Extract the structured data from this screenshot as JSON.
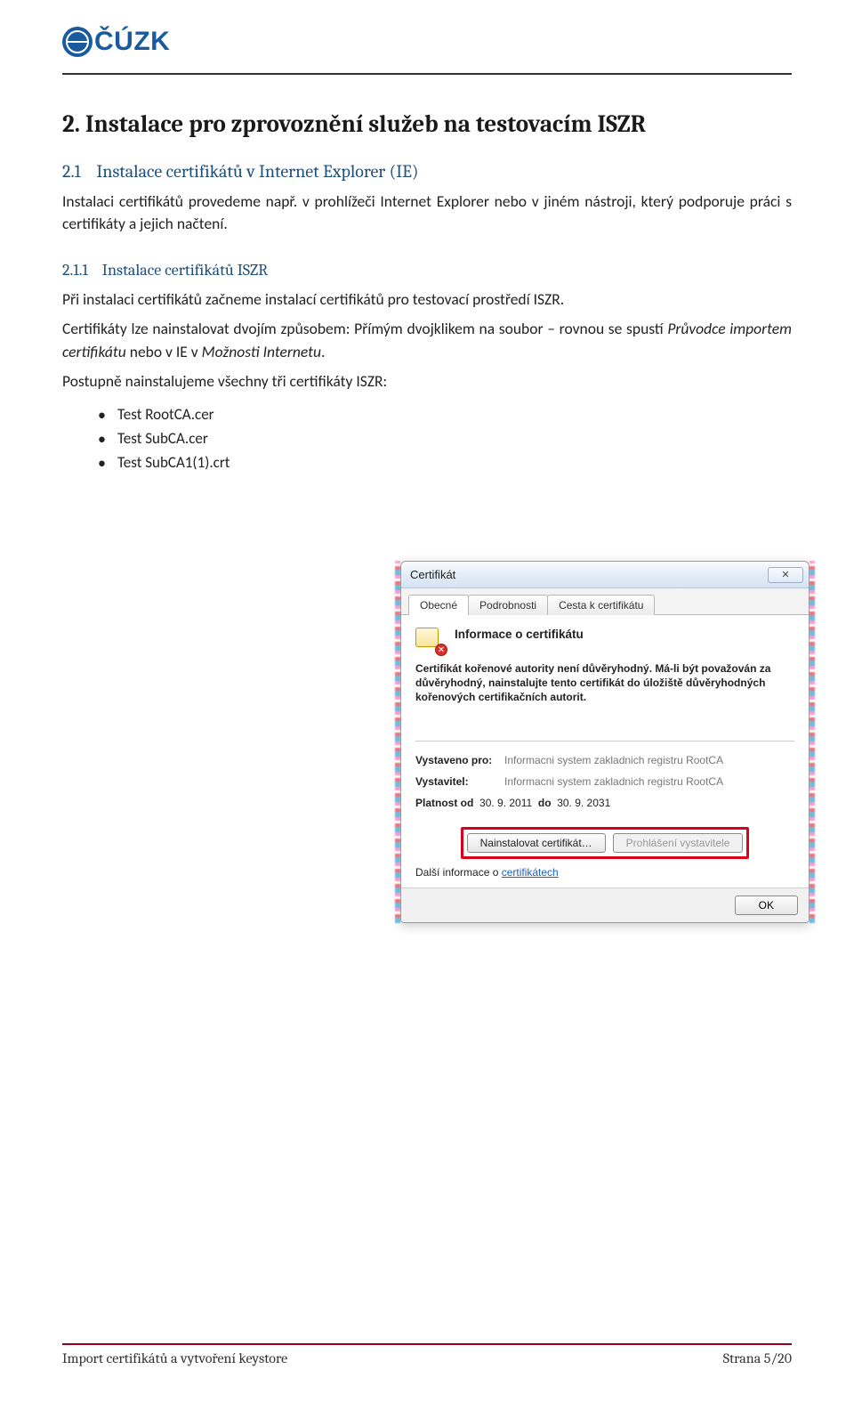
{
  "header": {
    "logo_text": "ČÚZK"
  },
  "section": {
    "number": "2.",
    "title": "Instalace pro zprovoznění služeb na testovacím ISZR"
  },
  "subsection": {
    "number": "2.1",
    "title": "Instalace certifikátů v Internet Explorer (IE)"
  },
  "para1_a": "Instalaci certifikátů provedeme např. v prohlížeči Internet Explorer nebo v jiném nástroji, který podporuje práci s certifikáty a jejich načtení.",
  "subsubsection": {
    "number": "2.1.1",
    "title": "Instalace certifikátů ISZR"
  },
  "para2": "Při instalaci certifikátů začneme instalací certifikátů pro testovací prostředí ISZR.",
  "para3_a": "Certifikáty lze nainstalovat dvojím způsobem: Přímým dvojklikem na soubor – rovnou se spustí ",
  "para3_i1": "Průvodce importem certifikátu",
  "para3_b": " nebo v IE v ",
  "para3_i2": "Možnosti Internetu",
  "para3_c": ".",
  "para4": "Postupně nainstalujeme všechny tři certifikáty ISZR:",
  "files": [
    "Test RootCA.cer",
    "Test SubCA.cer",
    "Test SubCA1(1).crt"
  ],
  "dialog": {
    "title": "Certifikát",
    "close_glyph": "✕",
    "tabs": [
      "Obecné",
      "Podrobnosti",
      "Cesta k certifikátu"
    ],
    "active_tab": 0,
    "cert_info_title": "Informace o certifikátu",
    "warning": "Certifikát kořenové autority není důvěryhodný. Má-li být považován za důvěryhodný, nainstalujte tento certifikát do úložiště důvěryhodných kořenových certifikačních autorit.",
    "issued_to_label": "Vystaveno pro:",
    "issued_to_value": "Informacni system zakladnich registru RootCA",
    "issuer_label": "Vystavitel:",
    "issuer_value": "Informacni system zakladnich registru RootCA",
    "valid_from_label": "Platnost od",
    "valid_from": "30. 9. 2011",
    "valid_to_label": "do",
    "valid_to": "30. 9. 2031",
    "install_btn": "Nainstalovat certifikát…",
    "statement_btn": "Prohlášení vystavitele",
    "more_info_prefix": "Další informace o ",
    "more_info_link": "certifikátech",
    "ok_btn": "OK"
  },
  "footer": {
    "left": "Import certifikátů a vytvoření keystore",
    "right": "Strana 5/20"
  }
}
